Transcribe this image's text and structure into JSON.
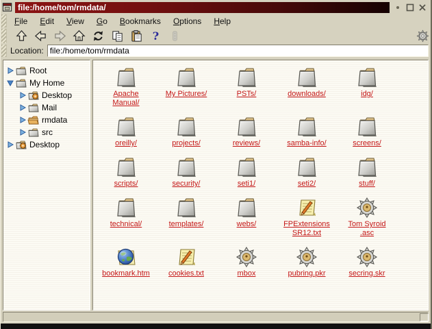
{
  "window": {
    "title": "file:/home/tom/rmdata/",
    "controls": [
      {
        "name": "sticky-button",
        "glyph": "dot"
      },
      {
        "name": "maximize-button",
        "glyph": "square"
      },
      {
        "name": "close-button",
        "glyph": "x"
      }
    ]
  },
  "colors": {
    "titlebar_red": "#7a1010",
    "window_tan": "#d6d2bf",
    "link_red": "#c41616",
    "pane_white": "#fcfbf4"
  },
  "menu": {
    "items": [
      {
        "label": "File",
        "accel": "F"
      },
      {
        "label": "Edit",
        "accel": "E"
      },
      {
        "label": "View",
        "accel": "V"
      },
      {
        "label": "Go",
        "accel": "G"
      },
      {
        "label": "Bookmarks",
        "accel": "B"
      },
      {
        "label": "Options",
        "accel": "O"
      },
      {
        "label": "Help",
        "accel": "H"
      }
    ]
  },
  "toolbar": {
    "buttons": [
      {
        "name": "up",
        "enabled": true
      },
      {
        "name": "back",
        "enabled": true
      },
      {
        "name": "forward",
        "enabled": false
      },
      {
        "name": "home",
        "enabled": true
      },
      {
        "name": "reload",
        "enabled": true
      },
      {
        "name": "copy",
        "enabled": true
      },
      {
        "name": "paste",
        "enabled": true
      },
      {
        "name": "help",
        "enabled": true
      },
      {
        "name": "stop",
        "enabled": false
      }
    ],
    "throbber": "kde-gear"
  },
  "location": {
    "label": "Location:",
    "value": "file:/home/tom/rmdata"
  },
  "tree": {
    "items": [
      {
        "label": "Root",
        "depth": 0,
        "expanded": false,
        "icon": "folder-closed"
      },
      {
        "label": "My Home",
        "depth": 0,
        "expanded": true,
        "icon": "folder-closed"
      },
      {
        "label": "Desktop",
        "depth": 1,
        "expanded": false,
        "icon": "folder-gear"
      },
      {
        "label": "Mail",
        "depth": 1,
        "expanded": false,
        "icon": "folder-closed"
      },
      {
        "label": "rmdata",
        "depth": 1,
        "expanded": false,
        "icon": "folder-open"
      },
      {
        "label": "src",
        "depth": 1,
        "expanded": false,
        "icon": "folder-closed"
      },
      {
        "label": "Desktop",
        "depth": 0,
        "expanded": false,
        "icon": "folder-gear"
      }
    ]
  },
  "files": {
    "items": [
      {
        "name": "Apache Manual/",
        "lines": [
          "Apache",
          "Manual/"
        ],
        "type": "folder"
      },
      {
        "name": "My Pictures/",
        "lines": [
          "My Pictures/"
        ],
        "type": "folder"
      },
      {
        "name": "PSTs/",
        "lines": [
          "PSTs/"
        ],
        "type": "folder"
      },
      {
        "name": "downloads/",
        "lines": [
          "downloads/"
        ],
        "type": "folder"
      },
      {
        "name": "idg/",
        "lines": [
          "idg/"
        ],
        "type": "folder"
      },
      {
        "name": "oreilly/",
        "lines": [
          "oreilly/"
        ],
        "type": "folder"
      },
      {
        "name": "projects/",
        "lines": [
          "projects/"
        ],
        "type": "folder"
      },
      {
        "name": "reviews/",
        "lines": [
          "reviews/"
        ],
        "type": "folder"
      },
      {
        "name": "samba-info/",
        "lines": [
          "samba-info/"
        ],
        "type": "folder"
      },
      {
        "name": "screens/",
        "lines": [
          "screens/"
        ],
        "type": "folder"
      },
      {
        "name": "scripts/",
        "lines": [
          "scripts/"
        ],
        "type": "folder"
      },
      {
        "name": "security/",
        "lines": [
          "security/"
        ],
        "type": "folder"
      },
      {
        "name": "seti1/",
        "lines": [
          "seti1/"
        ],
        "type": "folder"
      },
      {
        "name": "seti2/",
        "lines": [
          "seti2/"
        ],
        "type": "folder"
      },
      {
        "name": "stuff/",
        "lines": [
          "stuff/"
        ],
        "type": "folder"
      },
      {
        "name": "technical/",
        "lines": [
          "technical/"
        ],
        "type": "folder"
      },
      {
        "name": "templates/",
        "lines": [
          "templates/"
        ],
        "type": "folder"
      },
      {
        "name": "webs/",
        "lines": [
          "webs/"
        ],
        "type": "folder"
      },
      {
        "name": "FPExtensions SR12.txt",
        "lines": [
          "FPExtensions",
          "SR12.txt"
        ],
        "type": "notepad"
      },
      {
        "name": "Tom Syroid .asc",
        "lines": [
          "Tom Syroid",
          ".asc"
        ],
        "type": "gear"
      },
      {
        "name": "bookmark.htm",
        "lines": [
          "bookmark.htm"
        ],
        "type": "globe"
      },
      {
        "name": "cookies.txt",
        "lines": [
          "cookies.txt"
        ],
        "type": "notepad"
      },
      {
        "name": "mbox",
        "lines": [
          "mbox"
        ],
        "type": "gear"
      },
      {
        "name": "pubring.pkr",
        "lines": [
          "pubring.pkr"
        ],
        "type": "gear"
      },
      {
        "name": "secring.skr",
        "lines": [
          "secring.skr"
        ],
        "type": "gear"
      }
    ]
  }
}
